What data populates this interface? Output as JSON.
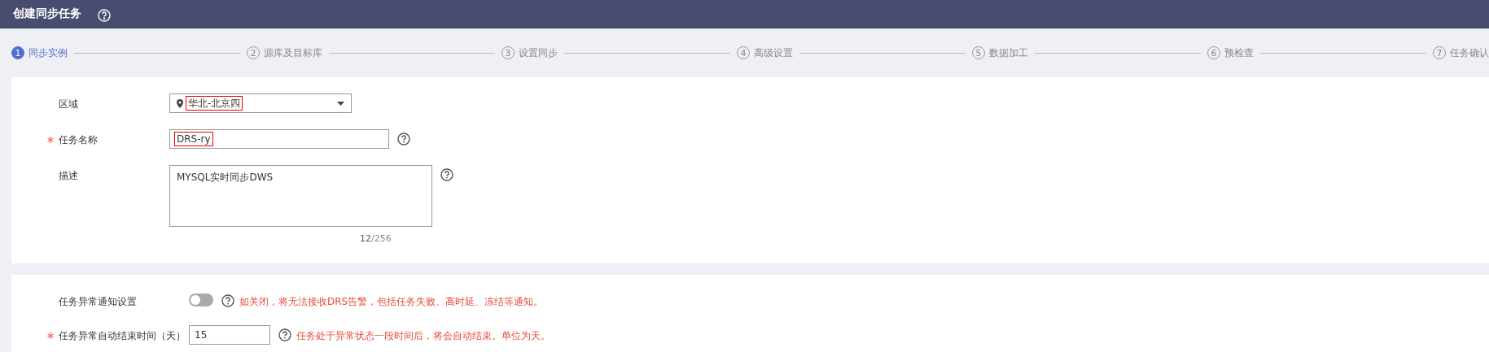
{
  "header": {
    "title": "创建同步任务"
  },
  "steps": [
    {
      "number": "1",
      "label": "同步实例",
      "selected": true
    },
    {
      "number": "2",
      "label": "源库及目标库",
      "selected": false
    },
    {
      "number": "3",
      "label": "设置同步",
      "selected": false
    },
    {
      "number": "4",
      "label": "高级设置",
      "selected": false
    },
    {
      "number": "5",
      "label": "数据加工",
      "selected": false
    },
    {
      "number": "6",
      "label": "预检查",
      "selected": false
    },
    {
      "number": "7",
      "label": "任务确认",
      "selected": false
    }
  ],
  "basic_form": {
    "region": {
      "label": "区域",
      "value": "华北-北京四",
      "highlighted": true
    },
    "task_name": {
      "label": "任务名称",
      "required": true,
      "value": "DRS-ry",
      "highlighted": true
    },
    "description": {
      "label": "描述",
      "value": "MYSQL实时同步DWS",
      "count": "12",
      "max": "/256"
    }
  },
  "notify_form": {
    "notify": {
      "label": "任务异常通知设置",
      "on": false,
      "hint": "如关闭，将无法接收DRS告警，包括任务失败、高时延、冻结等通知。"
    },
    "auto_end": {
      "label": "任务异常自动结束时间（天）",
      "required": true,
      "value": "15",
      "hint": "任务处于异常状态一段时间后，将会自动结束。单位为天。"
    }
  }
}
